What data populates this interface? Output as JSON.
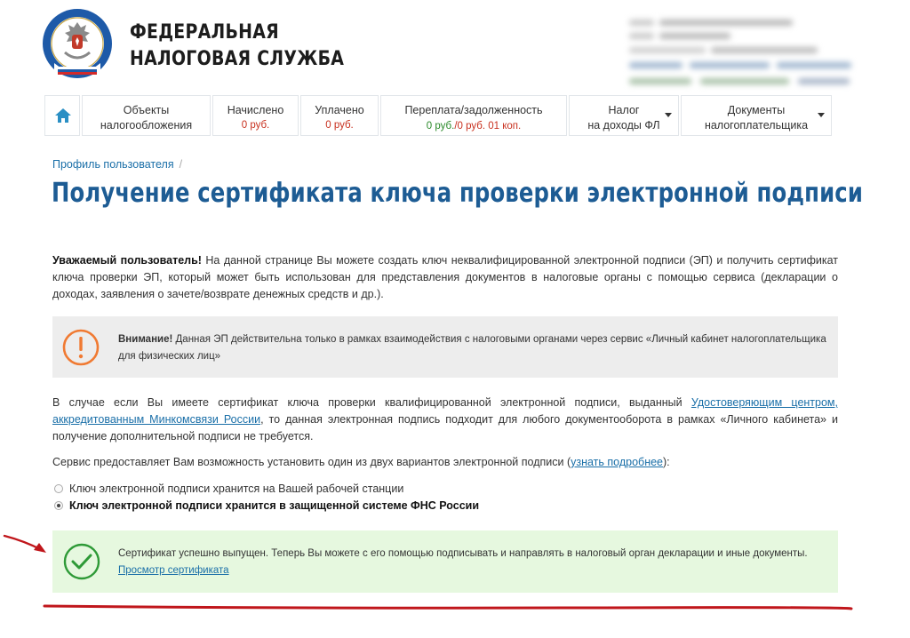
{
  "header": {
    "brand_line1": "ФЕДЕРАЛЬНАЯ",
    "brand_line2": "НАЛОГОВАЯ СЛУЖБА",
    "logo_icon": "fns-emblem-icon"
  },
  "nav": {
    "home_icon": "home-icon",
    "items": [
      {
        "line1": "Объекты",
        "line2": "налогообложения"
      },
      {
        "line1": "Начислено",
        "value": "0 руб."
      },
      {
        "line1": "Уплачено",
        "value": "0 руб."
      },
      {
        "line1": "Переплата/задолженность",
        "value_overpay": "0 руб.",
        "value_debt": "/0 руб. 01 коп."
      },
      {
        "line1": "Налог",
        "line2": "на доходы ФЛ"
      },
      {
        "line1": "Документы",
        "line2": "налогоплательщика"
      }
    ]
  },
  "breadcrumb": {
    "item": "Профиль пользователя",
    "separator": "/"
  },
  "page_title": "Получение сертификата ключа проверки электронной подписи",
  "intro": {
    "bold": "Уважаемый пользователь!",
    "text": " На данной странице Вы можете создать ключ неквалифицированной электронной подписи (ЭП) и получить сертификат ключа проверки ЭП, который может быть использован для представления документов в налоговые органы с помощью сервиса (декларации о доходах, заявления о зачете/возврате денежных средств и др.)."
  },
  "warning": {
    "bold": "Внимание!",
    "text": " Данная ЭП действительна только в рамках взаимодействия с налоговыми органами через сервис «Личный кабинет налогоплательщика для физических лиц»"
  },
  "qualified": {
    "text_before": "В случае если Вы имеете сертификат ключа проверки квалифицированной электронной подписи, выданный ",
    "link": "Удостоверяющим центром, аккредитованным Минкомсвязи России",
    "text_after": ", то данная электронная подпись подходит для любого документооборота в рамках «Личного кабинета» и получение дополнительной подписи не требуется."
  },
  "options_intro": {
    "text_before": "Сервис предоставляет Вам возможность установить один из двух вариантов электронной подписи (",
    "link": "узнать подробнее",
    "text_after": "):"
  },
  "options": [
    {
      "label": "Ключ электронной подписи хранится на Вашей рабочей станции",
      "selected": false
    },
    {
      "label": "Ключ электронной подписи хранится в защищенной системе ФНС России",
      "selected": true
    }
  ],
  "success": {
    "text": "Сертификат успешно выпущен. Теперь Вы можете с его помощью подписывать и направлять в налоговый орган декларации и иные документы.",
    "link": "Просмотр сертификата"
  },
  "colors": {
    "brand_blue": "#1d5c94",
    "link_blue": "#1a6fa8",
    "warning_orange": "#f07a32",
    "success_green": "#2e9a37",
    "annotation_red": "#c0161b"
  }
}
